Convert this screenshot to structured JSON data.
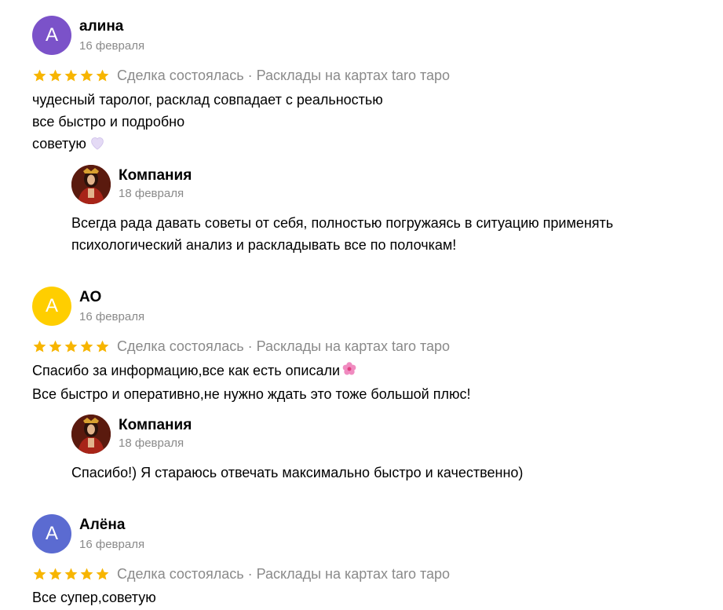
{
  "colors": {
    "star": "#f7b500",
    "muted_text": "#8a8a8a",
    "avatar_purple": "#7b52c9",
    "avatar_yellow": "#ffce00",
    "avatar_indigo": "#5b6bd1"
  },
  "reviews": [
    {
      "avatar_letter": "А",
      "avatar_color": "#7b52c9",
      "author": "алина",
      "date": "16 февраля",
      "rating": 5,
      "deal_info": "Сделка состоялась · Расклады на картах taro таро",
      "text_lines": [
        "чудесный таролог, расклад совпадает с реальностью",
        "все быстро и подробно",
        "советую"
      ],
      "reply": {
        "author": "Компания",
        "date": "18 февраля",
        "text_lines": [
          "Всегда рада давать советы от себя, полностью погружаясь в ситуацию применять",
          "психологический анализ и раскладывать все по полочкам!"
        ]
      }
    },
    {
      "avatar_letter": "А",
      "avatar_color": "#ffce00",
      "author": "АО",
      "date": "16 февраля",
      "rating": 5,
      "deal_info": "Сделка состоялась · Расклады на картах taro таро",
      "text_lines": [
        "Спасибо за информацию,все как есть описали",
        "Все быстро и оперативно,не нужно ждать это тоже большой плюс!"
      ],
      "reply": {
        "author": "Компания",
        "date": "18 февраля",
        "text_lines": [
          "Спасибо!) Я стараюсь отвечать максимально быстро и качественно)"
        ]
      }
    },
    {
      "avatar_letter": "А",
      "avatar_color": "#5b6bd1",
      "author": "Алёна",
      "date": "16 февраля",
      "rating": 5,
      "deal_info": "Сделка состоялась · Расклады на картах taro таро",
      "text_lines": [
        "Все супер,советую"
      ]
    }
  ]
}
